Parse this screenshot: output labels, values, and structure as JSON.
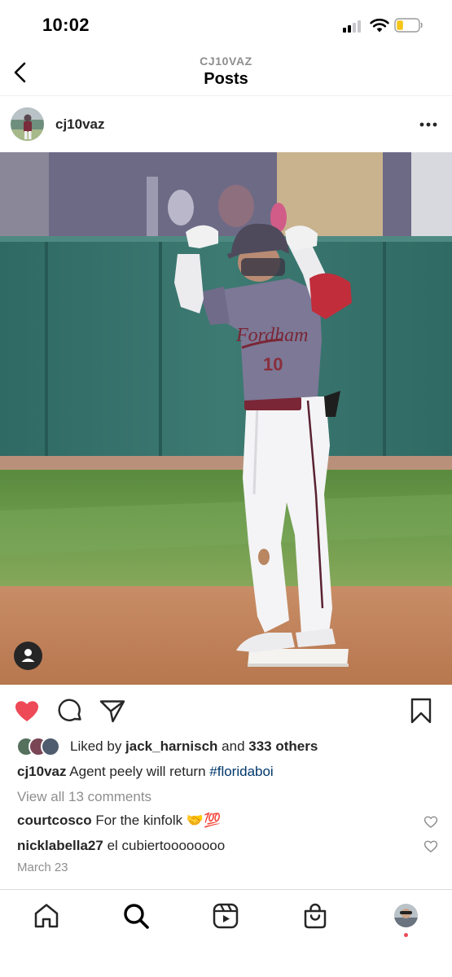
{
  "status_bar": {
    "time": "10:02"
  },
  "nav": {
    "subtitle": "CJ10VAZ",
    "title": "Posts"
  },
  "post": {
    "username": "cj10vaz",
    "image_alt": "Baseball player in gray Fordham uniform number 10 standing on second base with fists raised",
    "jersey_text": "Fordham",
    "jersey_number": "10",
    "liked": true,
    "likes": {
      "prefix": "Liked by ",
      "user": "jack_harnisch",
      "middle": " and ",
      "others": "333 others"
    },
    "caption": {
      "user": "cj10vaz",
      "text": " Agent peely will return ",
      "hashtag": "#floridaboi"
    },
    "view_comments": "View all 13 comments",
    "comments": [
      {
        "user": "courtcosco",
        "text": " For the kinfolk 🤝💯"
      },
      {
        "user": "nicklabella27",
        "text": " el cubiertoooooooo"
      }
    ],
    "date": "March 23"
  },
  "colors": {
    "like_red": "#ed4956",
    "hashtag": "#00376b",
    "secondary_text": "#8e8e8e"
  },
  "icons": [
    "back-icon",
    "more-icon",
    "heart-icon",
    "comment-icon",
    "share-icon",
    "save-icon",
    "home-icon",
    "search-icon",
    "reels-icon",
    "shop-icon"
  ]
}
